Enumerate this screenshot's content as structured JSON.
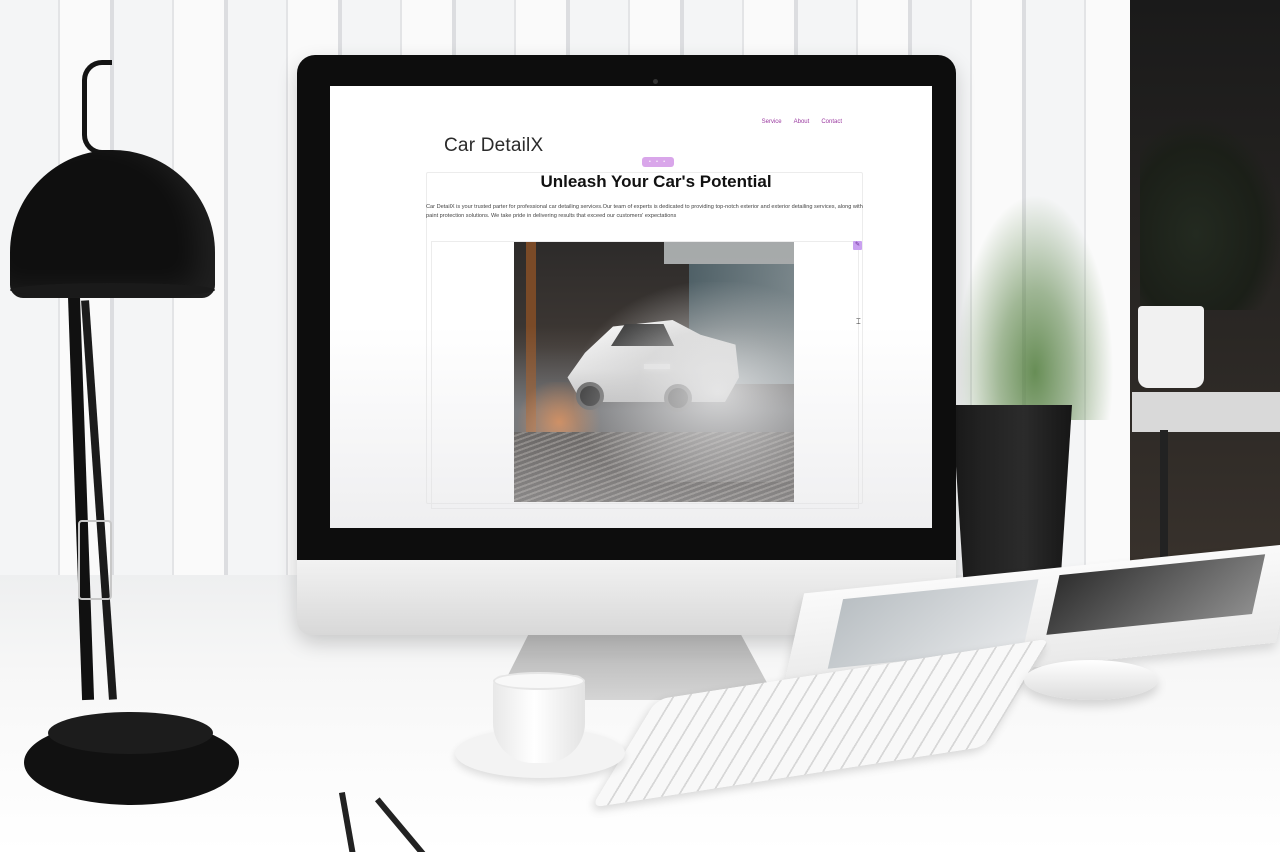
{
  "site": {
    "brand": "Car DetailX",
    "nav": {
      "items": [
        "Service",
        "About",
        "Contact"
      ]
    },
    "badge": "• • •",
    "headline": "Unleash Your Car's Potential",
    "intro": "Car DetailX is your trusted parter for professional car detailing services.Our team of experts is dedicated to providing top-notch exterior and exterior detailing services, along with paint protection solutions. We take pride in delivering results that exceed our customers' expectations",
    "edit_icon": "pencil-icon"
  },
  "colors": {
    "nav_link": "#9b3aa0",
    "badge": "#d9a6ea",
    "headline": "#111111",
    "brand": "#2b2b2b"
  }
}
